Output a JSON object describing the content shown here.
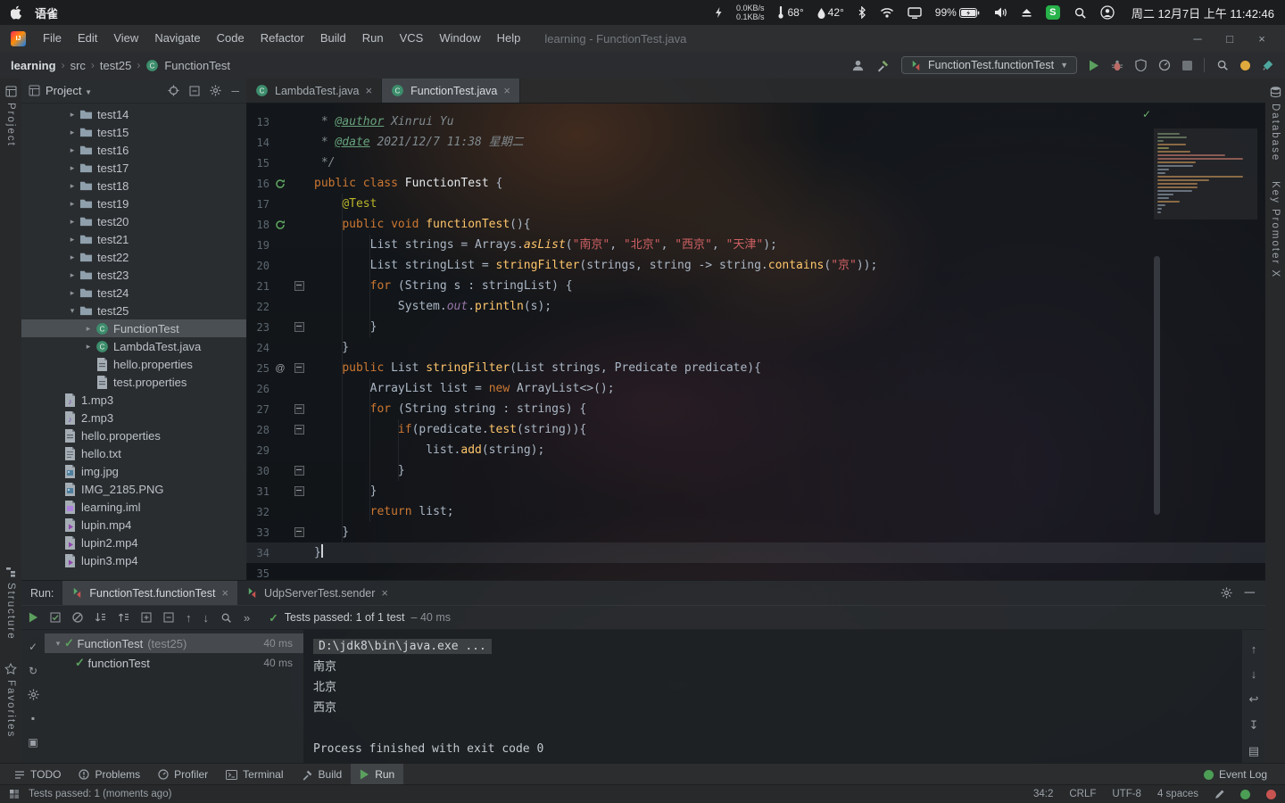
{
  "menubar": {
    "app_name": "语雀",
    "net_up": "0.0KB/s",
    "net_down": "0.1KB/s",
    "temperature": "68°",
    "humidity": "42°",
    "battery_percent": "99%",
    "clock": "周二 12月7日 上午 11:42:46"
  },
  "titlebar": {
    "menus": [
      "File",
      "Edit",
      "View",
      "Navigate",
      "Code",
      "Refactor",
      "Build",
      "Run",
      "VCS",
      "Window",
      "Help"
    ],
    "window_title": "learning - FunctionTest.java"
  },
  "navbar": {
    "breadcrumbs": [
      "learning",
      "src",
      "test25",
      "FunctionTest"
    ],
    "run_config": "FunctionTest.functionTest"
  },
  "left_stripe": {
    "top": "Project",
    "bottom": [
      "Structure",
      "Favorites"
    ]
  },
  "right_stripe": [
    "Database",
    "Key Promoter X"
  ],
  "glyphs": {
    "chevron_right": "▸",
    "chevron_down": "▾",
    "close": "×",
    "dropdown": "▾",
    "more": "»",
    "minimize": "─"
  },
  "project_panel": {
    "title": "Project",
    "tree": [
      {
        "label": "test14",
        "type": "folder",
        "indent": 1,
        "chevron": "right"
      },
      {
        "label": "test15",
        "type": "folder",
        "indent": 1,
        "chevron": "right"
      },
      {
        "label": "test16",
        "type": "folder",
        "indent": 1,
        "chevron": "right"
      },
      {
        "label": "test17",
        "type": "folder",
        "indent": 1,
        "chevron": "right"
      },
      {
        "label": "test18",
        "type": "folder",
        "indent": 1,
        "chevron": "right"
      },
      {
        "label": "test19",
        "type": "folder",
        "indent": 1,
        "chevron": "right"
      },
      {
        "label": "test20",
        "type": "folder",
        "indent": 1,
        "chevron": "right"
      },
      {
        "label": "test21",
        "type": "folder",
        "indent": 1,
        "chevron": "right"
      },
      {
        "label": "test22",
        "type": "folder",
        "indent": 1,
        "chevron": "right"
      },
      {
        "label": "test23",
        "type": "folder",
        "indent": 1,
        "chevron": "right"
      },
      {
        "label": "test24",
        "type": "folder",
        "indent": 1,
        "chevron": "right"
      },
      {
        "label": "test25",
        "type": "folder",
        "indent": 1,
        "chevron": "down"
      },
      {
        "label": "FunctionTest",
        "type": "class",
        "indent": 2,
        "chevron": "right",
        "selected": true
      },
      {
        "label": "LambdaTest.java",
        "type": "class",
        "indent": 2,
        "chevron": "right"
      },
      {
        "label": "hello.properties",
        "type": "properties",
        "indent": 2
      },
      {
        "label": "test.properties",
        "type": "properties",
        "indent": 2
      },
      {
        "label": "1.mp3",
        "type": "audio",
        "indent": 0
      },
      {
        "label": "2.mp3",
        "type": "audio",
        "indent": 0
      },
      {
        "label": "hello.properties",
        "type": "properties",
        "indent": 0
      },
      {
        "label": "hello.txt",
        "type": "text",
        "indent": 0
      },
      {
        "label": "img.jpg",
        "type": "image",
        "indent": 0
      },
      {
        "label": "IMG_2185.PNG",
        "type": "image",
        "indent": 0
      },
      {
        "label": "learning.iml",
        "type": "iml",
        "indent": 0
      },
      {
        "label": "lupin.mp4",
        "type": "video",
        "indent": 0
      },
      {
        "label": "lupin2.mp4",
        "type": "video",
        "indent": 0
      },
      {
        "label": "lupin3.mp4",
        "type": "video",
        "indent": 0
      }
    ]
  },
  "editor": {
    "tabs": [
      {
        "label": "LambdaTest.java",
        "active": false
      },
      {
        "label": "FunctionTest.java",
        "active": true
      }
    ],
    "lines": [
      {
        "n": 13,
        "segs": [
          [
            "c",
            " * "
          ],
          [
            "t",
            "@author"
          ],
          [
            "c",
            " Xinrui Yu"
          ]
        ]
      },
      {
        "n": 14,
        "segs": [
          [
            "c",
            " * "
          ],
          [
            "t",
            "@date"
          ],
          [
            "c",
            " 2021/12/7 11:38 星期二"
          ]
        ]
      },
      {
        "n": 15,
        "segs": [
          [
            "c",
            " */"
          ]
        ]
      },
      {
        "n": 16,
        "icon": "run",
        "segs": [
          [
            "k",
            "public class "
          ],
          [
            "cl",
            "FunctionTest "
          ],
          [
            "d",
            "{"
          ]
        ]
      },
      {
        "n": 17,
        "segs": [
          [
            "d",
            "    "
          ],
          [
            "a",
            "@Test"
          ]
        ]
      },
      {
        "n": 18,
        "icon": "run",
        "segs": [
          [
            "d",
            "    "
          ],
          [
            "k",
            "public void "
          ],
          [
            "m",
            "functionTest"
          ],
          [
            "d",
            "(){"
          ]
        ]
      },
      {
        "n": 19,
        "segs": [
          [
            "d",
            "        List<String> strings = Arrays."
          ],
          [
            "mi",
            "asList"
          ],
          [
            "d",
            "("
          ],
          [
            "s",
            "\"南京\""
          ],
          [
            "d",
            ", "
          ],
          [
            "s",
            "\"北京\""
          ],
          [
            "d",
            ", "
          ],
          [
            "s",
            "\"西京\""
          ],
          [
            "d",
            ", "
          ],
          [
            "s",
            "\"天津\""
          ],
          [
            "d",
            ");"
          ]
        ]
      },
      {
        "n": 20,
        "segs": [
          [
            "d",
            "        List<String> stringList = "
          ],
          [
            "m",
            "stringFilter"
          ],
          [
            "d",
            "(strings, string -> string."
          ],
          [
            "m",
            "contains"
          ],
          [
            "d",
            "("
          ],
          [
            "s",
            "\"京\""
          ],
          [
            "d",
            "));"
          ]
        ]
      },
      {
        "n": 21,
        "fold": true,
        "segs": [
          [
            "d",
            "        "
          ],
          [
            "k",
            "for"
          ],
          [
            "d",
            " (String s : stringList) {"
          ]
        ]
      },
      {
        "n": 22,
        "segs": [
          [
            "d",
            "            System."
          ],
          [
            "f",
            "out"
          ],
          [
            "d",
            "."
          ],
          [
            "m",
            "println"
          ],
          [
            "d",
            "(s);"
          ]
        ]
      },
      {
        "n": 23,
        "fold": true,
        "segs": [
          [
            "d",
            "        }"
          ]
        ]
      },
      {
        "n": 24,
        "segs": [
          [
            "d",
            "    }"
          ]
        ]
      },
      {
        "n": 25,
        "icon": "at",
        "fold": true,
        "segs": [
          [
            "d",
            "    "
          ],
          [
            "k",
            "public "
          ],
          [
            "d",
            "List<String> "
          ],
          [
            "m",
            "stringFilter"
          ],
          [
            "d",
            "(List<String> strings, Predicate<String> predicate){"
          ]
        ]
      },
      {
        "n": 26,
        "segs": [
          [
            "d",
            "        ArrayList<String> list = "
          ],
          [
            "k",
            "new"
          ],
          [
            "d",
            " ArrayList<>();"
          ]
        ]
      },
      {
        "n": 27,
        "fold": true,
        "segs": [
          [
            "d",
            "        "
          ],
          [
            "k",
            "for"
          ],
          [
            "d",
            " (String string : strings) {"
          ]
        ]
      },
      {
        "n": 28,
        "fold": true,
        "segs": [
          [
            "d",
            "            "
          ],
          [
            "k",
            "if"
          ],
          [
            "d",
            "(predicate."
          ],
          [
            "m",
            "test"
          ],
          [
            "d",
            "(string)){"
          ]
        ]
      },
      {
        "n": 29,
        "segs": [
          [
            "d",
            "                list."
          ],
          [
            "m",
            "add"
          ],
          [
            "d",
            "(string);"
          ]
        ]
      },
      {
        "n": 30,
        "fold": true,
        "segs": [
          [
            "d",
            "            }"
          ]
        ]
      },
      {
        "n": 31,
        "fold": true,
        "segs": [
          [
            "d",
            "        }"
          ]
        ]
      },
      {
        "n": 32,
        "segs": [
          [
            "d",
            "        "
          ],
          [
            "k",
            "return"
          ],
          [
            "d",
            " list;"
          ]
        ]
      },
      {
        "n": 33,
        "fold": true,
        "segs": [
          [
            "d",
            "    }"
          ]
        ]
      },
      {
        "n": 34,
        "cur": true,
        "segs": [
          [
            "d",
            "}"
          ]
        ]
      },
      {
        "n": 35,
        "segs": []
      }
    ]
  },
  "run_panel": {
    "label": "Run:",
    "tabs": [
      {
        "label": "FunctionTest.functionTest",
        "active": true
      },
      {
        "label": "UdpServerTest.sender",
        "active": false
      }
    ],
    "toolbar_icons": [
      "rerun",
      "rerun-failed",
      "stop",
      "sort-desc",
      "sort-asc",
      "expand-all",
      "collapse-all",
      "previous-failed",
      "next-failed",
      "search",
      "more"
    ],
    "side_icons": [
      "hide-passed",
      "rerun-auto",
      "test-settings",
      "stop-square",
      "screenshot"
    ],
    "console_icons": [
      "scroll-up",
      "scroll-down",
      "soft-wrap",
      "scroll-to-end",
      "print"
    ],
    "status_text": "Tests passed: 1 of 1 test",
    "status_time": "– 40 ms",
    "tree": [
      {
        "label": "FunctionTest",
        "suffix": "(test25)",
        "time": "40 ms",
        "selected": true,
        "indent": 0
      },
      {
        "label": "functionTest",
        "suffix": "",
        "time": "40 ms",
        "selected": false,
        "indent": 1
      }
    ],
    "console": {
      "command": "D:\\jdk8\\bin\\java.exe ...",
      "output": [
        "南京",
        "北京",
        "西京"
      ],
      "exit_text": "Process finished with exit code 0"
    }
  },
  "bottom_bar": {
    "items": [
      {
        "label": "TODO",
        "active": false
      },
      {
        "label": "Problems",
        "active": false
      },
      {
        "label": "Profiler",
        "active": false
      },
      {
        "label": "Terminal",
        "active": false
      },
      {
        "label": "Build",
        "active": false
      },
      {
        "label": "Run",
        "active": true
      }
    ],
    "event_log": "Event Log"
  },
  "status_bar": {
    "message": "Tests passed: 1 (moments ago)",
    "caret": "34:2",
    "line_ending": "CRLF",
    "encoding": "UTF-8",
    "indent": "4 spaces"
  }
}
